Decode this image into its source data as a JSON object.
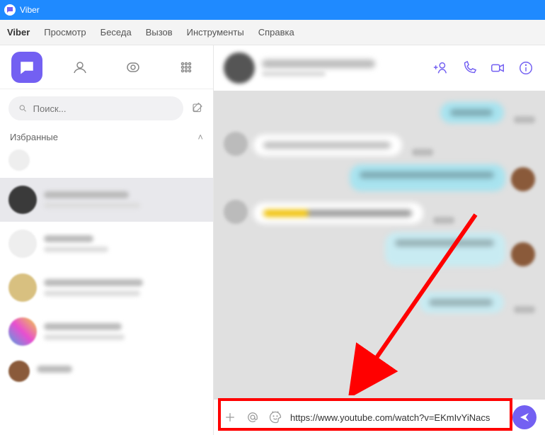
{
  "titlebar": {
    "app": "Viber"
  },
  "menu": {
    "items": [
      "Viber",
      "Просмотр",
      "Беседа",
      "Вызов",
      "Инструменты",
      "Справка"
    ]
  },
  "sidebar": {
    "search_placeholder": "Поиск...",
    "favorites_label": "Избранные"
  },
  "input": {
    "value": "https://www.youtube.com/watch?v=EKmIvYiNacs"
  },
  "colors": {
    "accent": "#7360f2",
    "titlebar": "#1f8aff",
    "highlight": "#ff0000"
  }
}
